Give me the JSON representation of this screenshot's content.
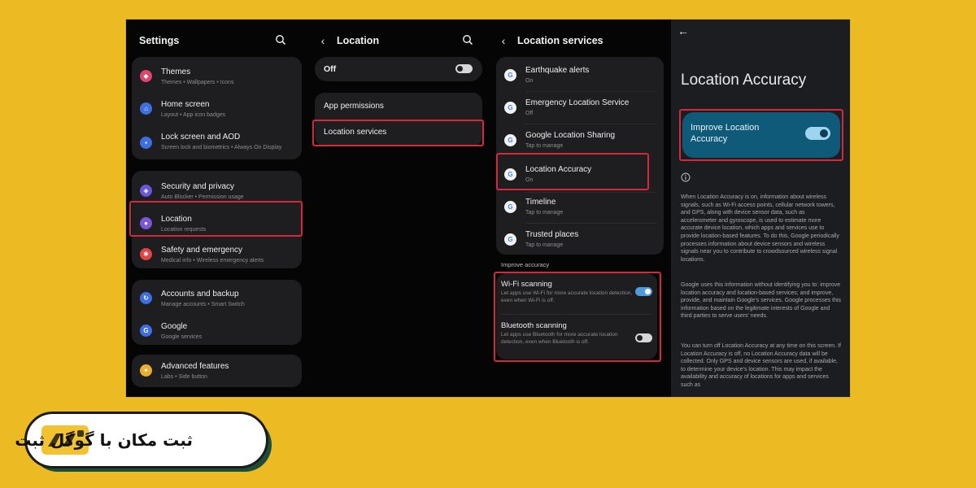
{
  "colors": {
    "background": "#ecba22",
    "highlight": "#d5283a",
    "accent": "#4f9cd8",
    "teal_card": "#0f5a78"
  },
  "settings": {
    "title": "Settings",
    "groups": [
      [
        {
          "label": "Themes",
          "sub": "Themes • Wallpapers • Icons",
          "icon": "themes-icon",
          "color": "#e0456b"
        },
        {
          "label": "Home screen",
          "sub": "Layout • App icon badges",
          "icon": "home-icon",
          "color": "#3e6fe0"
        },
        {
          "label": "Lock screen and AOD",
          "sub": "Screen lock and biometrics • Always On Display",
          "icon": "lock-icon",
          "color": "#3e6fe0"
        }
      ],
      [
        {
          "label": "Security and privacy",
          "sub": "Auto Blocker • Permission usage",
          "icon": "shield-icon",
          "color": "#6b57d6"
        },
        {
          "label": "Location",
          "sub": "Location requests",
          "icon": "location-icon",
          "color": "#7a57d8"
        },
        {
          "label": "Safety and emergency",
          "sub": "Medical info • Wireless emergency alerts",
          "icon": "emergency-icon",
          "color": "#e04444"
        }
      ],
      [
        {
          "label": "Accounts and backup",
          "sub": "Manage accounts • Smart Switch",
          "icon": "accounts-icon",
          "color": "#3e6fe0"
        },
        {
          "label": "Google",
          "sub": "Google services",
          "icon": "google-icon",
          "color": "#3e6fe0"
        }
      ],
      [
        {
          "label": "Advanced features",
          "sub": "Labs • Side button",
          "icon": "advanced-features-icon",
          "color": "#e8b030"
        }
      ]
    ]
  },
  "location": {
    "title": "Location",
    "master_label": "Off",
    "items": [
      "App permissions",
      "Location services"
    ]
  },
  "location_services": {
    "title": "Location services",
    "items": [
      {
        "label": "Earthquake alerts",
        "sub": "On"
      },
      {
        "label": "Emergency Location Service",
        "sub": "Off"
      },
      {
        "label": "Google Location Sharing",
        "sub": "Tap to manage"
      },
      {
        "label": "Location Accuracy",
        "sub": "On"
      },
      {
        "label": "Timeline",
        "sub": "Tap to manage"
      },
      {
        "label": "Trusted places",
        "sub": "Tap to manage"
      }
    ],
    "improve_header": "Improve accuracy",
    "wifi": {
      "label": "Wi-Fi scanning",
      "desc": "Let apps use Wi-Fi for more accurate location detection, even when Wi-Fi is off.",
      "on": true
    },
    "bluetooth": {
      "label": "Bluetooth scanning",
      "desc": "Let apps use Bluetooth for more accurate location detection, even when Bluetooth is off.",
      "on": false
    }
  },
  "accuracy": {
    "title": "Location Accuracy",
    "toggle_label": "Improve Location Accuracy",
    "toggle_on": true,
    "para1": "When Location Accuracy is on, information about wireless signals, such as Wi-Fi access points, cellular network towers, and GPS, along with device sensor data, such as accelerometer and gyroscope, is used to estimate more accurate device location, which apps and services use to provide location-based features. To do this, Google periodically processes information about device sensors and wireless signals near you to contribute to crowdsourced wireless signal locations.",
    "para2": "Google uses this information without identifying you to: improve location accuracy and location-based services; and improve, provide, and maintain Google's services. Google processes this information based on the legitimate interests of Google and third parties to serve users' needs.",
    "para3": "You can turn off Location Accuracy at any time on this screen. If Location Accuracy is off, no Location Accuracy data will be collected. Only GPS and device sensors are used, if available, to determine your device's location. This may impact the availability and accuracy of locations for apps and services such as"
  },
  "badge": {
    "text": "ثبت مکان با گوگل ثبت"
  }
}
